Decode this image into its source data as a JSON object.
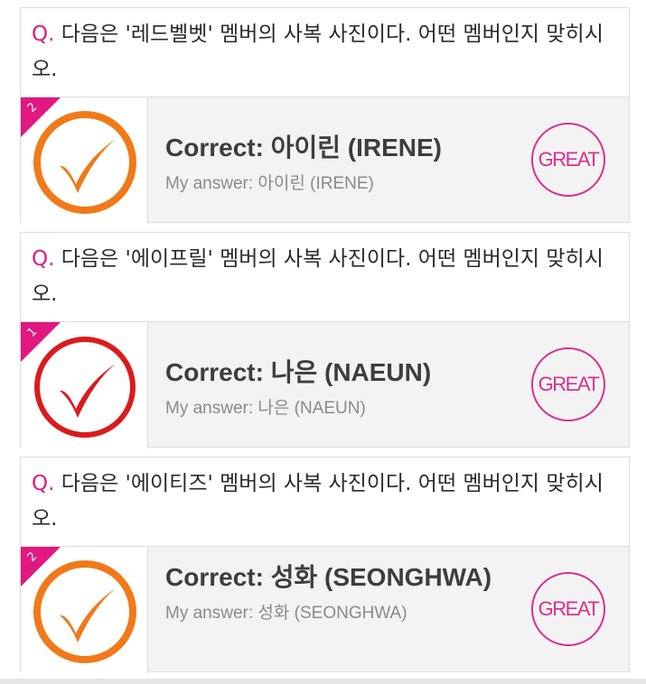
{
  "items": [
    {
      "question_prefix": "Q.",
      "question_text": "다음은 '레드벨벳' 멤버의 사복 사진이다. 어떤 멤버인지 맞히시오.",
      "corner_number": "2",
      "correct_label": "Correct: 아이린 (IRENE)",
      "my_answer": "My answer: 아이린 (IRENE)",
      "badge": "GREAT",
      "check_color": "#f07a1a"
    },
    {
      "question_prefix": "Q.",
      "question_text": "다음은 '에이프릴' 멤버의 사복 사진이다. 어떤 멤버인지 맞히시오.",
      "corner_number": "1",
      "correct_label": "Correct: 나은 (NAEUN)",
      "my_answer": "My answer: 나은 (NAEUN)",
      "badge": "GREAT",
      "check_color": "#d91c1c"
    },
    {
      "question_prefix": "Q.",
      "question_text": "다음은 '에이티즈' 멤버의 사복 사진이다. 어떤 멤버인지 맞히시오.",
      "corner_number": "2",
      "correct_label": "Correct: 성화 (SEONGHWA)",
      "my_answer": "My answer: 성화 (SEONGHWA)",
      "badge": "GREAT",
      "check_color": "#f07a1a"
    }
  ],
  "colors": {
    "accent": "#e0187f",
    "badge": "#dc2e8d",
    "card_bg": "#f3f3f3"
  }
}
